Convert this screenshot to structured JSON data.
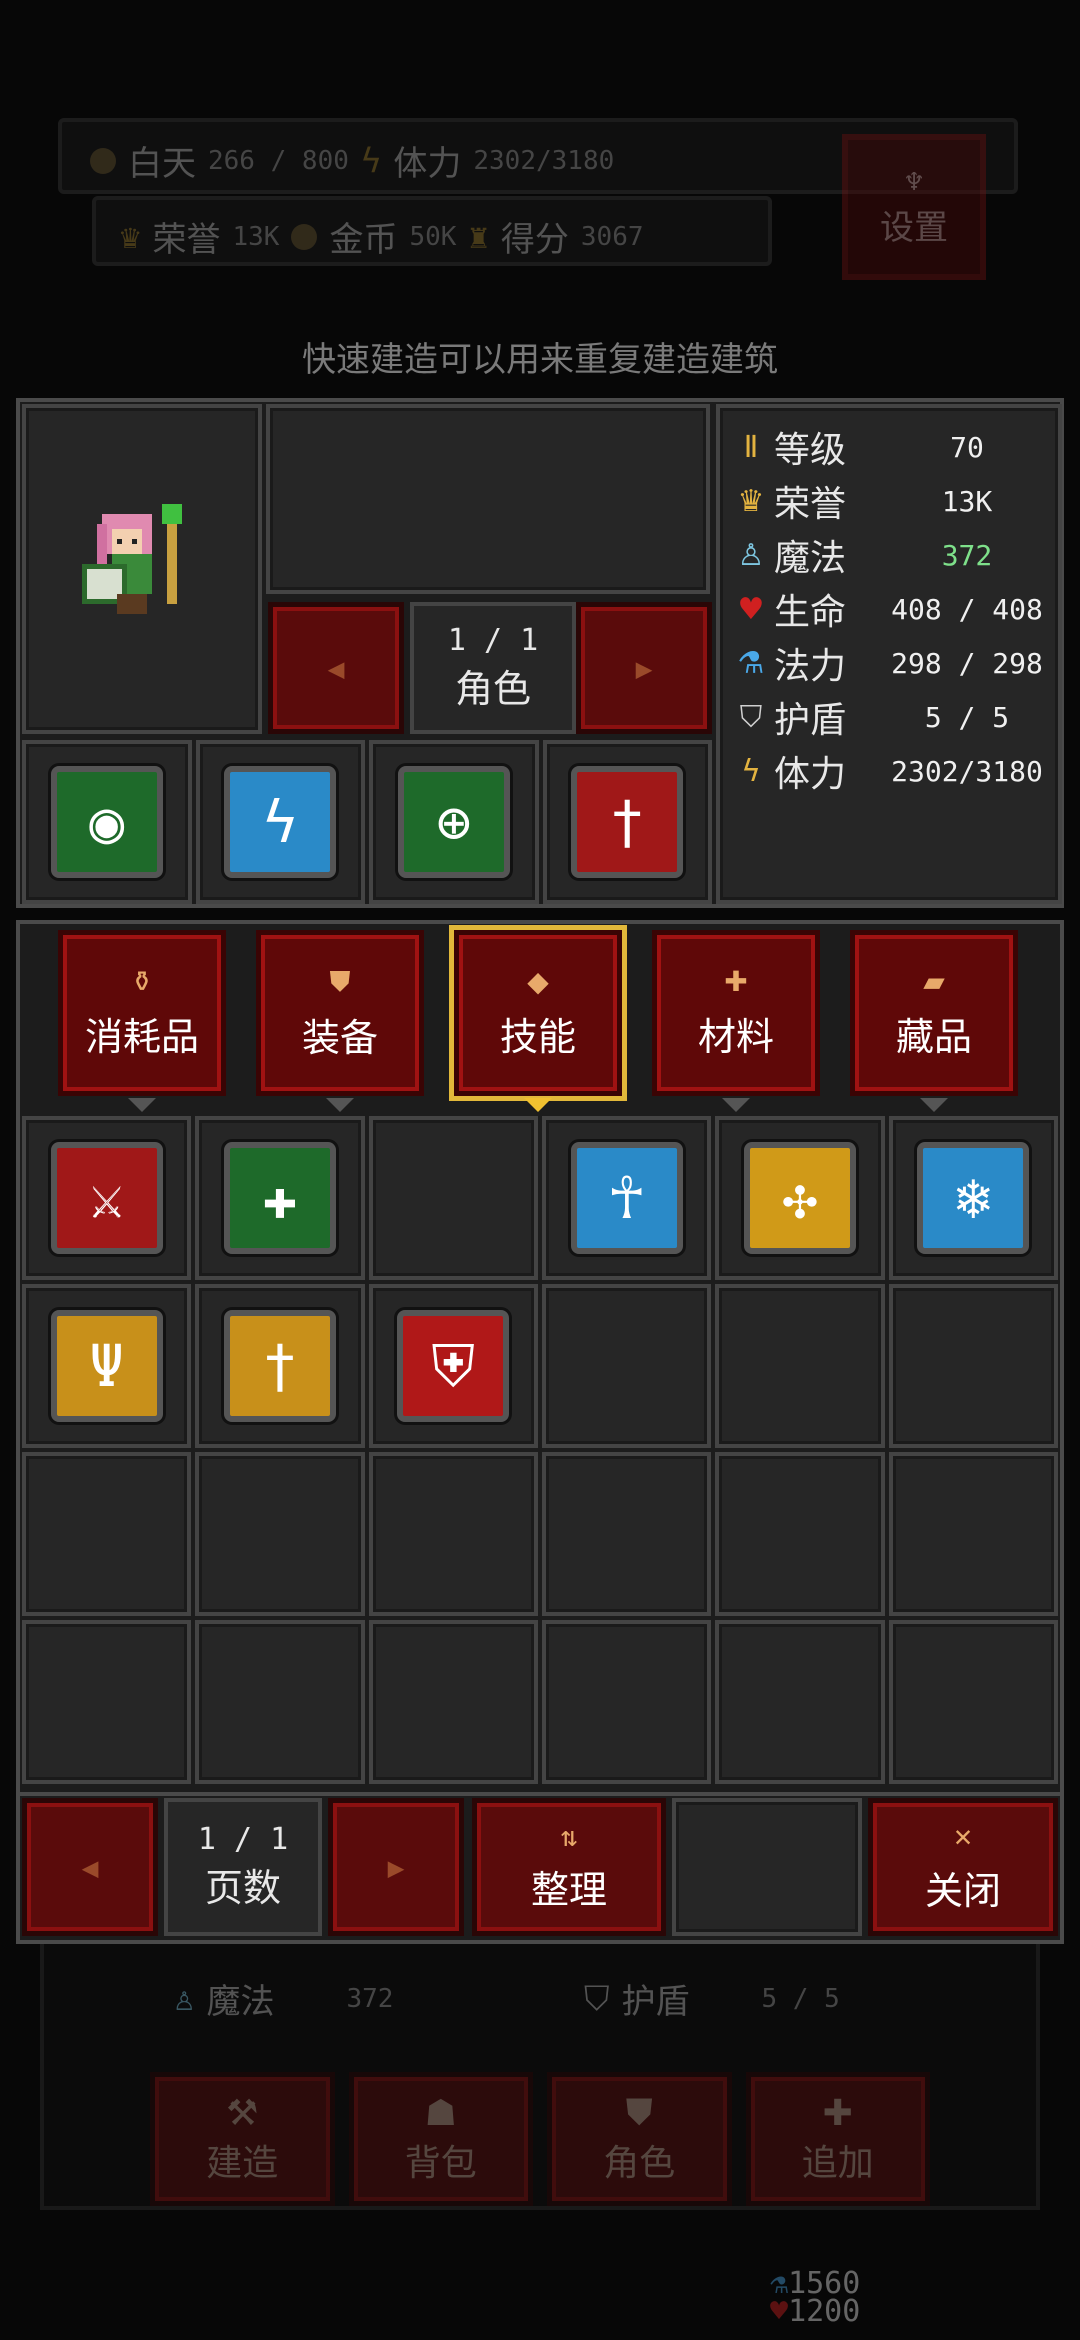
{
  "hud": {
    "day_label": "白天",
    "day_value": "266 / 800",
    "stamina_label": "体力",
    "stamina_value": "2302/3180",
    "honor_label": "荣誉",
    "honor_value": "13K",
    "gold_label": "金币",
    "gold_value": "50K",
    "score_label": "得分",
    "score_value": "3067",
    "settings_label": "设置"
  },
  "hint": "快速建造可以用来重复建造建筑",
  "character": {
    "page": "1 / 1",
    "label": "角色",
    "stats": [
      {
        "icon": "level-icon",
        "glyph": "Ⅱ",
        "color": "#e3b340",
        "label": "等级",
        "value": "70",
        "vcolor": "#f0f0f0"
      },
      {
        "icon": "crown-icon",
        "glyph": "♛",
        "color": "#e3b340",
        "label": "荣誉",
        "value": "13K",
        "vcolor": "#f0f0f0"
      },
      {
        "icon": "magic-icon",
        "glyph": "♙",
        "color": "#7ec6e0",
        "label": "魔法",
        "value": "372",
        "vcolor": "#7ee08a"
      },
      {
        "icon": "heart-icon",
        "glyph": "♥",
        "color": "#d02020",
        "label": "生命",
        "value": "408 / 408",
        "vcolor": "#f0f0f0"
      },
      {
        "icon": "mana-potion-icon",
        "glyph": "⚗",
        "color": "#4aa8e8",
        "label": "法力",
        "value": "298 / 298",
        "vcolor": "#f0f0f0"
      },
      {
        "icon": "shield-icon",
        "glyph": "⛉",
        "color": "#d0d0d0",
        "label": "护盾",
        "value": "5 / 5",
        "vcolor": "#f0f0f0"
      },
      {
        "icon": "stamina-icon",
        "glyph": "ϟ",
        "color": "#e3b340",
        "label": "体力",
        "value": "2302/3180",
        "vcolor": "#f0f0f0"
      }
    ],
    "equipped_skills": [
      {
        "name": "eye-skill-icon",
        "glyph": "◉",
        "bg": "#1e6a2a"
      },
      {
        "name": "lightning-skill-icon",
        "glyph": "ϟ",
        "bg": "#2a8ac8"
      },
      {
        "name": "target-skill-icon",
        "glyph": "⊕",
        "bg": "#1e6a2a"
      },
      {
        "name": "blade-skill-icon",
        "glyph": "†",
        "bg": "#a01818"
      }
    ]
  },
  "tabs": [
    {
      "label": "消耗品",
      "icon": "potion-tab-icon",
      "glyph": "⚱",
      "active": false
    },
    {
      "label": "装备",
      "icon": "shield-tab-icon",
      "glyph": "⛊",
      "active": false
    },
    {
      "label": "技能",
      "icon": "diamond-tab-icon",
      "glyph": "◆",
      "active": true
    },
    {
      "label": "材料",
      "icon": "cross-tab-icon",
      "glyph": "✚",
      "active": false
    },
    {
      "label": "藏品",
      "icon": "scroll-tab-icon",
      "glyph": "▰",
      "active": false
    }
  ],
  "skills": [
    {
      "name": "sword-skill-icon",
      "glyph": "⚔",
      "bg": "#a01818"
    },
    {
      "name": "holy-cross-skill-icon",
      "glyph": "✚",
      "bg": "#1e6a2a"
    },
    null,
    {
      "name": "ankh-skill-icon",
      "glyph": "☥",
      "bg": "#2a8ac8"
    },
    {
      "name": "gold-burst-skill-icon",
      "glyph": "✣",
      "bg": "#d09a18"
    },
    {
      "name": "frost-spirit-skill-icon",
      "glyph": "❄",
      "bg": "#2a8ac8"
    },
    {
      "name": "fork-skill-icon",
      "glyph": "Ψ",
      "bg": "#c8901a"
    },
    {
      "name": "gold-sword-skill-icon",
      "glyph": "†",
      "bg": "#c8901a"
    },
    {
      "name": "crusader-shield-skill-icon",
      "glyph": "⛨",
      "bg": "#b01818"
    }
  ],
  "footer": {
    "page": "1 / 1",
    "page_label": "页数",
    "sort_label": "整理",
    "close_label": "关闭"
  },
  "background_panel": {
    "magic_label": "魔法",
    "magic_value": "372",
    "shield_label": "护盾",
    "shield_value": "5 / 5",
    "nav": [
      "建造",
      "背包",
      "角色",
      "追加"
    ],
    "counter1": "1560",
    "counter2": "1200"
  }
}
